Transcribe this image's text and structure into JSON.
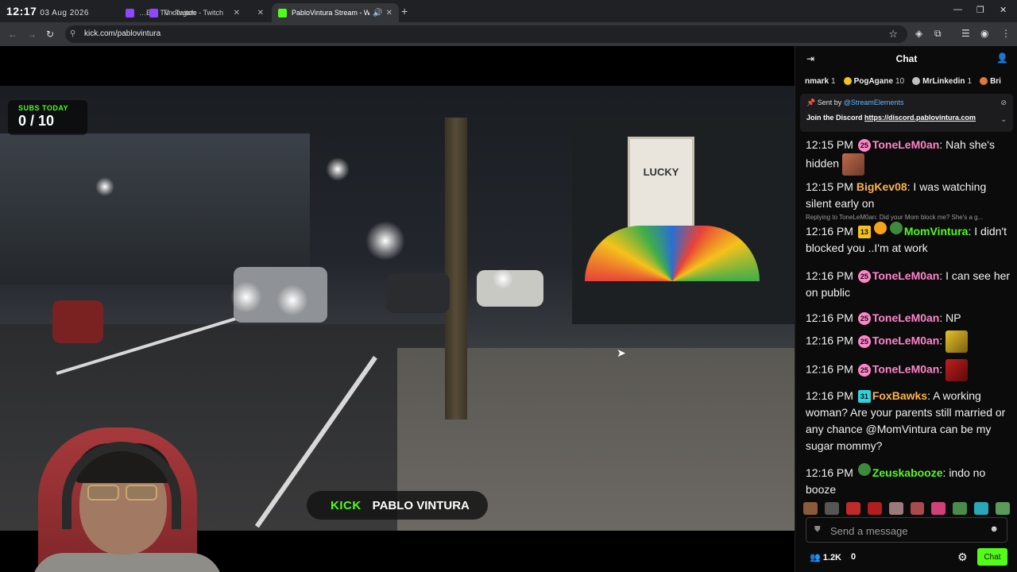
{
  "clock": {
    "time": "12:17",
    "date": "03 Aug 2026"
  },
  "browser": {
    "tabs": [
      {
        "title": "…Ball TV - Twitch",
        "favicon_color": "#9146ff",
        "active": false
      },
      {
        "title": "Tindergate - Twitch",
        "favicon_color": "#9146ff",
        "active": false
      },
      {
        "title": "PabloVintura Stream - Wat…",
        "favicon_color": "#53fc18",
        "active": true
      }
    ],
    "url": "kick.com/pablovintura"
  },
  "video": {
    "subs_label": "SUBS TODAY",
    "subs_value": "0 / 10",
    "sign_text": "LUCKY",
    "brand": "KICK",
    "streamer": "PABLO VINTURA"
  },
  "chat": {
    "title": "Chat",
    "gifters": [
      {
        "name": "nmark",
        "count": "1",
        "color": "#e07a3a"
      },
      {
        "name": "PogAgane",
        "count": "10",
        "color": "#f4c21b"
      },
      {
        "name": "MrLinkedin",
        "count": "1",
        "color": "#c0c0c0"
      },
      {
        "name": "Bri",
        "count": "",
        "color": "#e07a3a"
      }
    ],
    "pinned": {
      "sent_by_label": "Sent by",
      "sender": "@StreamElements",
      "message": "Join the Discord",
      "link": "https://discord.pablovintura.com"
    },
    "reply_note": "Replying to ToneLeM0an: Did your Mom block me? She's a g...",
    "messages": [
      {
        "time": "12:15 PM",
        "user": "ToneLeM0an",
        "user_color": "#ff85c8",
        "badge": "25",
        "badge_color": "#ff85c8",
        "text": "Nah she's hidden"
      },
      {
        "time": "12:15 PM",
        "user": "BigKev08",
        "user_color": "#ffb347",
        "badge": "",
        "text": "I was watching silent early on"
      },
      {
        "time": "12:16 PM",
        "user": "MomVintura",
        "user_color": "#53fc18",
        "badge": "13",
        "badge_color": "#f4c21b",
        "text": "I didn't blocked you ..I'm at work"
      },
      {
        "time": "12:16 PM",
        "user": "ToneLeM0an",
        "user_color": "#ff85c8",
        "badge": "25",
        "badge_color": "#ff85c8",
        "text": "I can see her on public"
      },
      {
        "time": "12:16 PM",
        "user": "ToneLeM0an",
        "user_color": "#ff85c8",
        "badge": "25",
        "badge_color": "#ff85c8",
        "text": "NP"
      },
      {
        "time": "12:16 PM",
        "user": "ToneLeM0an",
        "user_color": "#ff85c8",
        "badge": "25",
        "badge_color": "#ff85c8",
        "text": ""
      },
      {
        "time": "12:16 PM",
        "user": "ToneLeM0an",
        "user_color": "#ff85c8",
        "badge": "25",
        "badge_color": "#ff85c8",
        "text": ""
      },
      {
        "time": "12:16 PM",
        "user": "FoxBawks",
        "user_color": "#ffb347",
        "badge": "31",
        "badge_color": "#2fd3e0",
        "text": "A working woman? Are your parents still married or any chance @MomVintura can be my sugar mommy?"
      },
      {
        "time": "12:16 PM",
        "user": "Zeuskabooze",
        "user_color": "#53fc18",
        "badge": "",
        "text": "indo no booze"
      }
    ],
    "input_placeholder": "Send a message",
    "viewers": "1.2K",
    "second_count": "0",
    "send_label": "Chat"
  }
}
